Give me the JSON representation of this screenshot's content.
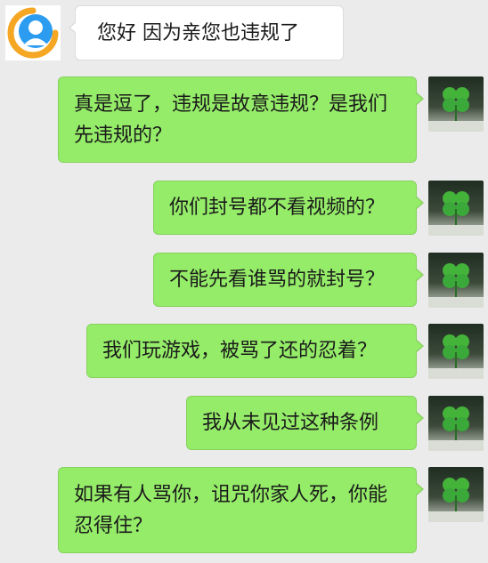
{
  "messages": [
    {
      "sender": "service",
      "text": "您好 因为亲您也违规了"
    },
    {
      "sender": "self",
      "text": "真是逗了，违规是故意违规？是我们先违规的？"
    },
    {
      "sender": "self",
      "text": "你们封号都不看视频的？"
    },
    {
      "sender": "self",
      "text": "不能先看谁骂的就封号？"
    },
    {
      "sender": "self",
      "text": "我们玩游戏，被骂了还的忍着？"
    },
    {
      "sender": "self",
      "text": "我从未见过这种条例"
    },
    {
      "sender": "self",
      "text": "如果有人骂你，诅咒你家人死，你能忍得住？"
    }
  ],
  "avatars": {
    "service": {
      "icon": "customer-service-icon",
      "color": "#2b9cf0",
      "accent": "#f5a623"
    },
    "self": {
      "icon": "four-leaf-clover-icon",
      "color": "#3ba83a"
    }
  },
  "colors": {
    "background": "#ebebeb",
    "incoming_bubble": "#ffffff",
    "outgoing_bubble": "#95ec69"
  }
}
